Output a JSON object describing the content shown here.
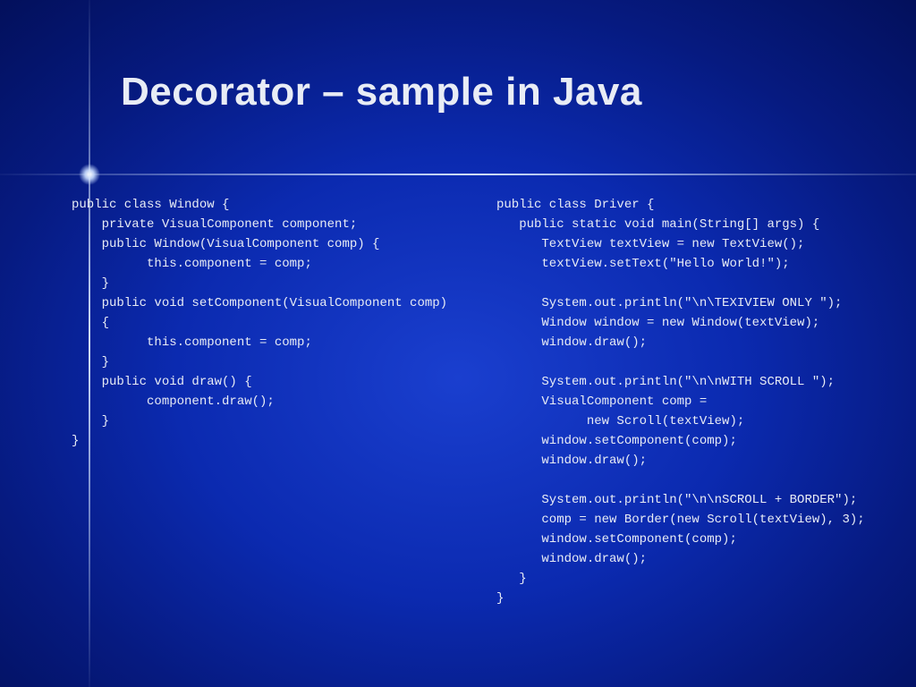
{
  "title": "Decorator – sample in Java",
  "code_left": "public class Window {\n    private VisualComponent component;\n    public Window(VisualComponent comp) {\n          this.component = comp;\n    }\n    public void setComponent(VisualComponent comp)\n    {\n          this.component = comp;\n    }\n    public void draw() {\n          component.draw();\n    }\n}",
  "code_right": "public class Driver {\n   public static void main(String[] args) {\n      TextView textView = new TextView();\n      textView.setText(\"Hello World!\");\n\n      System.out.println(\"\\n\\TEXIVIEW ONLY \");\n      Window window = new Window(textView);\n      window.draw();\n\n      System.out.println(\"\\n\\nWITH SCROLL \");\n      VisualComponent comp =\n            new Scroll(textView);\n      window.setComponent(comp);\n      window.draw();\n\n      System.out.println(\"\\n\\nSCROLL + BORDER\");\n      comp = new Border(new Scroll(textView), 3);\n      window.setComponent(comp);\n      window.draw();\n   }\n}"
}
